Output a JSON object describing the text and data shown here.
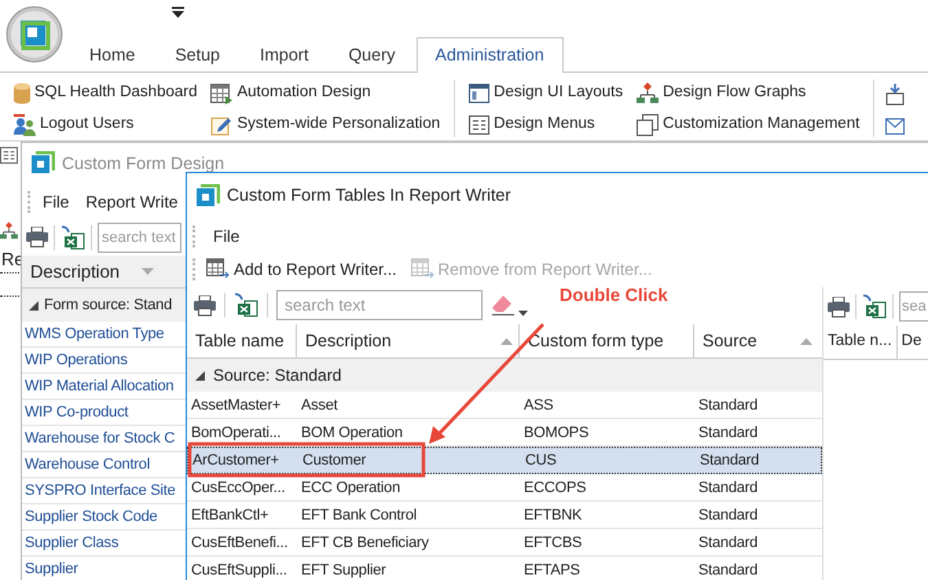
{
  "ribbon": {
    "tabs": [
      {
        "label": "Home",
        "selected": false
      },
      {
        "label": "Setup",
        "selected": false
      },
      {
        "label": "Import",
        "selected": false
      },
      {
        "label": "Query",
        "selected": false
      },
      {
        "label": "Administration",
        "selected": true
      }
    ],
    "groups": [
      {
        "columns": [
          [
            "SQL Health Dashboard",
            "Logout Users"
          ],
          [
            "Automation Design",
            "System-wide Personalization"
          ]
        ]
      },
      {
        "columns": [
          [
            "Design UI Layouts",
            "Design Menus"
          ],
          [
            "Design Flow Graphs",
            "Customization Management"
          ]
        ]
      }
    ]
  },
  "background": {
    "label": "Re"
  },
  "form_design_window": {
    "title": "Custom Form Design",
    "menu": [
      "File",
      "Report Write"
    ],
    "search": {
      "placeholder": "search text"
    },
    "column": "Description",
    "group": {
      "label": "Form source: Stand",
      "expanded": true
    },
    "rows": [
      "WMS Operation Type",
      "WIP Operations",
      "WIP Material Allocation",
      "WIP Co-product",
      "Warehouse for Stock C",
      "Warehouse Control",
      "SYSPRO Interface Site",
      "Supplier Stock Code",
      "Supplier Class",
      "Supplier"
    ]
  },
  "tables_window": {
    "title": "Custom Form Tables In Report Writer",
    "menu": [
      "File"
    ],
    "actions": [
      {
        "label": "Add to Report Writer...",
        "disabled": false
      },
      {
        "label": "Remove from Report Writer...",
        "disabled": true
      }
    ],
    "search": {
      "placeholder": "search text"
    },
    "columns": [
      "Table name",
      "Description",
      "Custom form type",
      "Source"
    ],
    "group": {
      "label": "Source: Standard",
      "expanded": true
    },
    "rows": [
      {
        "cells": [
          "AssetMaster+",
          "Asset",
          "ASS",
          "Standard"
        ],
        "selected": false
      },
      {
        "cells": [
          "BomOperati...",
          "BOM Operation",
          "BOMOPS",
          "Standard"
        ],
        "selected": false
      },
      {
        "cells": [
          "ArCustomer+",
          "Customer",
          "CUS",
          "Standard"
        ],
        "selected": true
      },
      {
        "cells": [
          "CusEccOper...",
          "ECC Operation",
          "ECCOPS",
          "Standard"
        ],
        "selected": false
      },
      {
        "cells": [
          "EftBankCtl+",
          "EFT Bank Control",
          "EFTBNK",
          "Standard"
        ],
        "selected": false
      },
      {
        "cells": [
          "CusEftBenefi...",
          "EFT CB Beneficiary",
          "EFTCBS",
          "Standard"
        ],
        "selected": false
      },
      {
        "cells": [
          "CusEftSuppli...",
          "EFT Supplier",
          "EFTAPS",
          "Standard"
        ],
        "selected": false
      }
    ],
    "side_panel": {
      "search": {
        "placeholder": "sea"
      },
      "columns": [
        "Table n...",
        "De"
      ]
    }
  },
  "annotation": {
    "label": "Double Click"
  }
}
